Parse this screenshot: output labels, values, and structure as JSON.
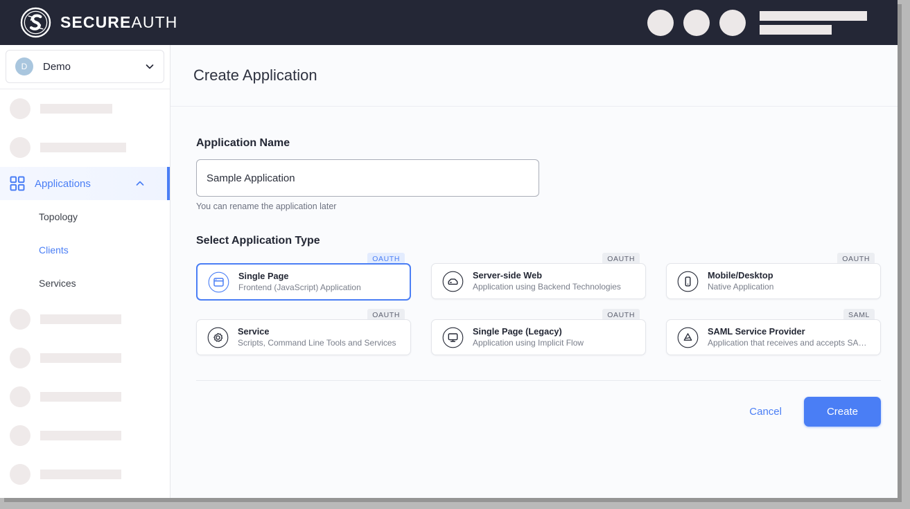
{
  "topbar": {
    "logo_icon": "secureauth-circular-s-logo",
    "brand_bold": "SECURE",
    "brand_light": "AUTH",
    "redacted_circles": 3,
    "redacted_bars": 2,
    "background_color": "#242736"
  },
  "sidebar": {
    "tenant": {
      "avatar_initial": "D",
      "name": "Demo",
      "chevron_icon": "chevron-down-icon"
    },
    "redacted_top_items": 2,
    "nav": {
      "icon": "grid-icon",
      "label": "Applications",
      "chevron_icon": "chevron-up-icon",
      "expanded": true,
      "active_color": "#4a7ef5"
    },
    "sub_items": [
      {
        "label": "Topology",
        "selected": false
      },
      {
        "label": "Clients",
        "selected": true
      },
      {
        "label": "Services",
        "selected": false
      }
    ],
    "redacted_bottom_items": 5
  },
  "main": {
    "page_title": "Create Application",
    "application_name": {
      "label": "Application Name",
      "value": "Sample Application",
      "placeholder": "Application Name",
      "help": "You can rename the application later"
    },
    "select_type_label": "Select Application Type",
    "app_types": [
      {
        "badge": "OAUTH",
        "title": "Single Page",
        "subtitle": "Frontend (JavaScript) Application",
        "icon": "browser-window-icon",
        "selected": true
      },
      {
        "badge": "OAUTH",
        "title": "Server-side Web",
        "subtitle": "Application using Backend Technologies",
        "icon": "server-icon",
        "selected": false
      },
      {
        "badge": "OAUTH",
        "title": "Mobile/Desktop",
        "subtitle": "Native Application",
        "icon": "smartphone-icon",
        "selected": false
      },
      {
        "badge": "OAUTH",
        "title": "Service",
        "subtitle": "Scripts, Command Line Tools and Services",
        "icon": "gear-icon",
        "selected": false
      },
      {
        "badge": "OAUTH",
        "title": "Single Page (Legacy)",
        "subtitle": "Application using Implicit Flow",
        "icon": "monitor-icon",
        "selected": false
      },
      {
        "badge": "SAML",
        "title": "SAML Service Provider",
        "subtitle": "Application that receives and accepts SAML asse...",
        "icon": "saml-triangle-icon",
        "selected": false
      }
    ],
    "footer": {
      "cancel_label": "Cancel",
      "create_label": "Create",
      "primary_color": "#4a7ef5"
    }
  }
}
